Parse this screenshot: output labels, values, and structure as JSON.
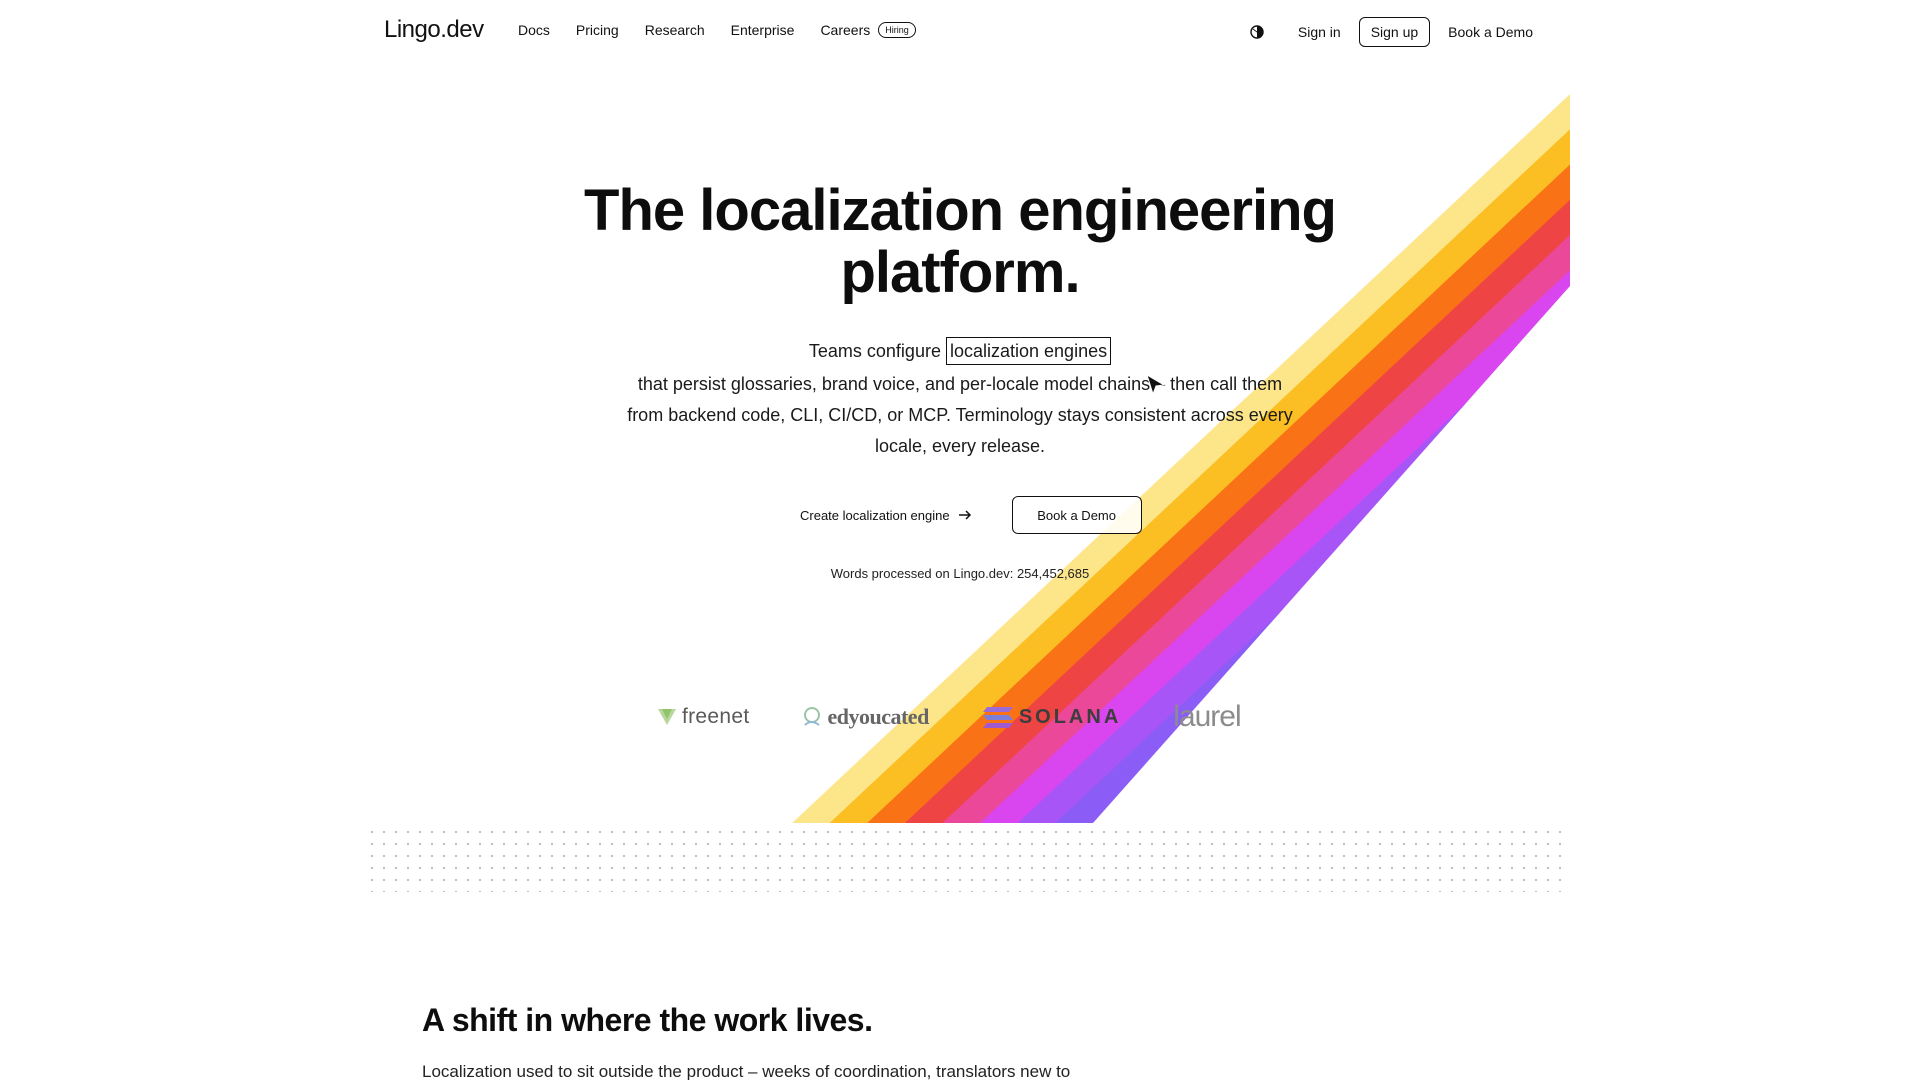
{
  "nav": {
    "logo": "Lingo.dev",
    "links": [
      "Docs",
      "Pricing",
      "Research",
      "Enterprise",
      "Careers"
    ],
    "hiring_badge": "Hiring",
    "theme_icon": "contrast-icon",
    "sign_in": "Sign in",
    "sign_up": "Sign up",
    "book_demo": "Book a Demo"
  },
  "hero": {
    "title": "The localization engineering platform.",
    "sub_prefix": "Teams configure",
    "sub_highlight": "localization engines",
    "sub_rest": "that persist glossaries, brand voice, and per-locale model chains – then call them from backend code, CLI, CI/CD, or MCP. Terminology stays consistent across every locale, every release.",
    "cta_primary": "Create localization engine",
    "cta_primary_icon": "arrow-right-icon",
    "cta_secondary": "Book a Demo",
    "words_processed": "Words processed on Lingo.dev: 254,452,685"
  },
  "stripe_colors": [
    "#fde68a",
    "#fbbf24",
    "#f97316",
    "#ef4444",
    "#ec4899",
    "#d946ef",
    "#a855f7",
    "#8b5cf6"
  ],
  "logos": [
    "freenet",
    "edyoucated",
    "SOLANA",
    "laurel"
  ],
  "section2": {
    "title": "A shift in where the work lives.",
    "body": "Localization used to sit outside the product – weeks of coordination, translators new to"
  }
}
